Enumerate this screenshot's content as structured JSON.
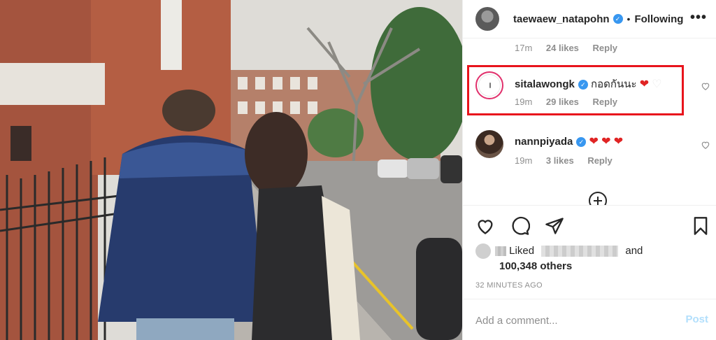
{
  "header": {
    "username": "taewaew_natapohn",
    "separator": "•",
    "follow_label": "Following",
    "more_label": "•••",
    "verified_glyph": "✓"
  },
  "comments_cut": {
    "time": "17m",
    "likes": "24 likes",
    "reply": "Reply"
  },
  "comments": [
    {
      "username": "sitalawongk",
      "text": "กอดกันนะ",
      "emojis": [
        "❤",
        "♡"
      ],
      "time": "19m",
      "likes": "29 likes",
      "reply": "Reply",
      "highlighted": true
    },
    {
      "username": "nannpiyada",
      "text": "",
      "emojis": [
        "❤",
        "❤",
        "❤"
      ],
      "time": "19m",
      "likes": "3 likes",
      "reply": "Reply",
      "highlighted": false
    }
  ],
  "actions": {
    "like_icon": "heart-icon",
    "comment_icon": "comment-icon",
    "share_icon": "paper-plane-icon",
    "save_icon": "bookmark-icon"
  },
  "likes": {
    "liked_word": "Liked",
    "and_word": "and",
    "count_text": "100,348 others"
  },
  "timestamp": "32 MINUTES AGO",
  "add_comment": {
    "placeholder": "Add a comment...",
    "post_label": "Post"
  },
  "colors": {
    "verified": "#3897f0",
    "highlight_box": "#e8141c",
    "post_disabled": "#b2dffc",
    "heart_red": "#e02424"
  }
}
